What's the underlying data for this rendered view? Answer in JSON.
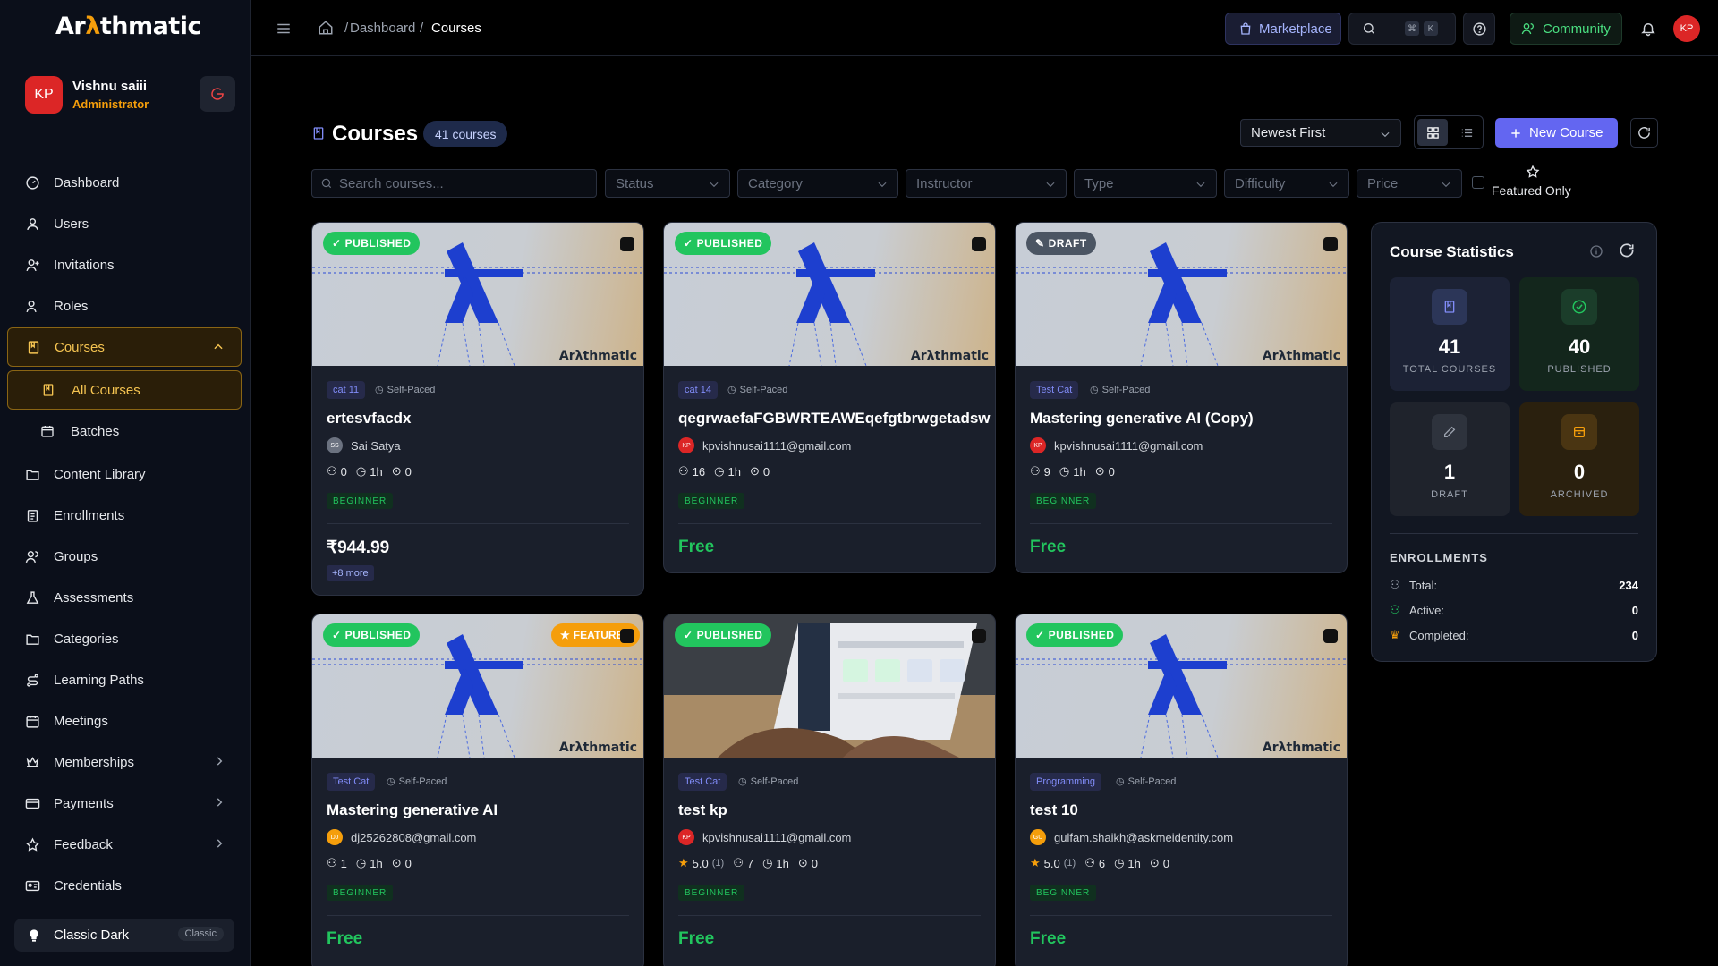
{
  "app": {
    "logo_prefix": "Ar",
    "logo_accent": "λ",
    "logo_suffix": "thmatic"
  },
  "user": {
    "initials": "KP",
    "name": "Vishnu saiii",
    "role": "Administrator"
  },
  "nav": {
    "dashboard": "Dashboard",
    "users": "Users",
    "invitations": "Invitations",
    "roles": "Roles",
    "courses": "Courses",
    "all_courses": "All Courses",
    "batches": "Batches",
    "content_library": "Content Library",
    "enrollments": "Enrollments",
    "groups": "Groups",
    "assessments": "Assessments",
    "categories": "Categories",
    "learning_paths": "Learning Paths",
    "meetings": "Meetings",
    "memberships": "Memberships",
    "payments": "Payments",
    "feedback": "Feedback",
    "credentials": "Credentials"
  },
  "theme": {
    "name": "Classic Dark",
    "badge": "Classic"
  },
  "breadcrumb": {
    "sep": "/",
    "dashboard": "Dashboard",
    "current": "Courses"
  },
  "topbar": {
    "marketplace": "Marketplace",
    "kbd1": "⌘",
    "kbd2": "K",
    "community": "Community",
    "avatar": "KP"
  },
  "page": {
    "title": "Courses",
    "count": "41 courses",
    "sort": "Newest First",
    "new_course": "New Course"
  },
  "filters": {
    "search_placeholder": "Search courses...",
    "status": "Status",
    "category": "Category",
    "instructor": "Instructor",
    "type": "Type",
    "difficulty": "Difficulty",
    "price": "Price",
    "featured_only": "Featured Only"
  },
  "thumb_brand": "Arλthmatic",
  "courses": [
    {
      "status": "PUBLISHED",
      "category": "cat 11",
      "pace": "Self-Paced",
      "title": "ertesvfacdx",
      "instructor": "Sai Satya",
      "inst_initials": "SS",
      "rating": "",
      "reviews": "",
      "students": "0",
      "duration": "1h",
      "lessons": "0",
      "level": "BEGINNER",
      "price": "₹944.99",
      "more": "+8 more"
    },
    {
      "status": "PUBLISHED",
      "category": "cat 14",
      "pace": "Self-Paced",
      "title": "qegrwaefaFGBWRTEAWEqefgtbrwgetadsw",
      "instructor": "kpvishnusai1111@gmail.com",
      "inst_initials": "KP",
      "rating": "",
      "reviews": "",
      "students": "16",
      "duration": "1h",
      "lessons": "0",
      "level": "BEGINNER",
      "price": "Free",
      "more": ""
    },
    {
      "status": "DRAFT",
      "category": "Test Cat",
      "pace": "Self-Paced",
      "title": "Mastering generative AI (Copy)",
      "instructor": "kpvishnusai1111@gmail.com",
      "inst_initials": "KP",
      "rating": "",
      "reviews": "",
      "students": "9",
      "duration": "1h",
      "lessons": "0",
      "level": "BEGINNER",
      "price": "Free",
      "more": ""
    },
    {
      "status": "PUBLISHED",
      "featured": "FEATURED",
      "category": "Test Cat",
      "pace": "Self-Paced",
      "title": "Mastering generative AI",
      "instructor": "dj25262808@gmail.com",
      "inst_initials": "DJ",
      "rating": "",
      "reviews": "",
      "students": "1",
      "duration": "1h",
      "lessons": "0",
      "level": "BEGINNER",
      "price": "Free",
      "more": ""
    },
    {
      "status": "PUBLISHED",
      "category": "Test Cat",
      "pace": "Self-Paced",
      "title": "test kp",
      "instructor": "kpvishnusai1111@gmail.com",
      "inst_initials": "KP",
      "rating": "5.0",
      "reviews": "(1)",
      "students": "7",
      "duration": "1h",
      "lessons": "0",
      "level": "BEGINNER",
      "price": "Free",
      "more": ""
    },
    {
      "status": "PUBLISHED",
      "category": "Programming",
      "pace": "Self-Paced",
      "title": "test 10",
      "instructor": "gulfam.shaikh@askmeidentity.com",
      "inst_initials": "GU",
      "rating": "5.0",
      "reviews": "(1)",
      "students": "6",
      "duration": "1h",
      "lessons": "0",
      "level": "BEGINNER",
      "price": "Free",
      "more": ""
    }
  ],
  "stats": {
    "title": "Course Statistics",
    "total": "41",
    "total_label": "TOTAL COURSES",
    "published": "40",
    "published_label": "PUBLISHED",
    "draft": "1",
    "draft_label": "DRAFT",
    "archived": "0",
    "archived_label": "ARCHIVED",
    "enrollments_title": "ENROLLMENTS",
    "total_enr_label": "Total:",
    "total_enr": "234",
    "active_label": "Active:",
    "active": "0",
    "completed_label": "Completed:",
    "completed": "0"
  },
  "colors": {
    "accent": "#f59e0b",
    "primary": "#6366f1",
    "success": "#22c55e"
  }
}
